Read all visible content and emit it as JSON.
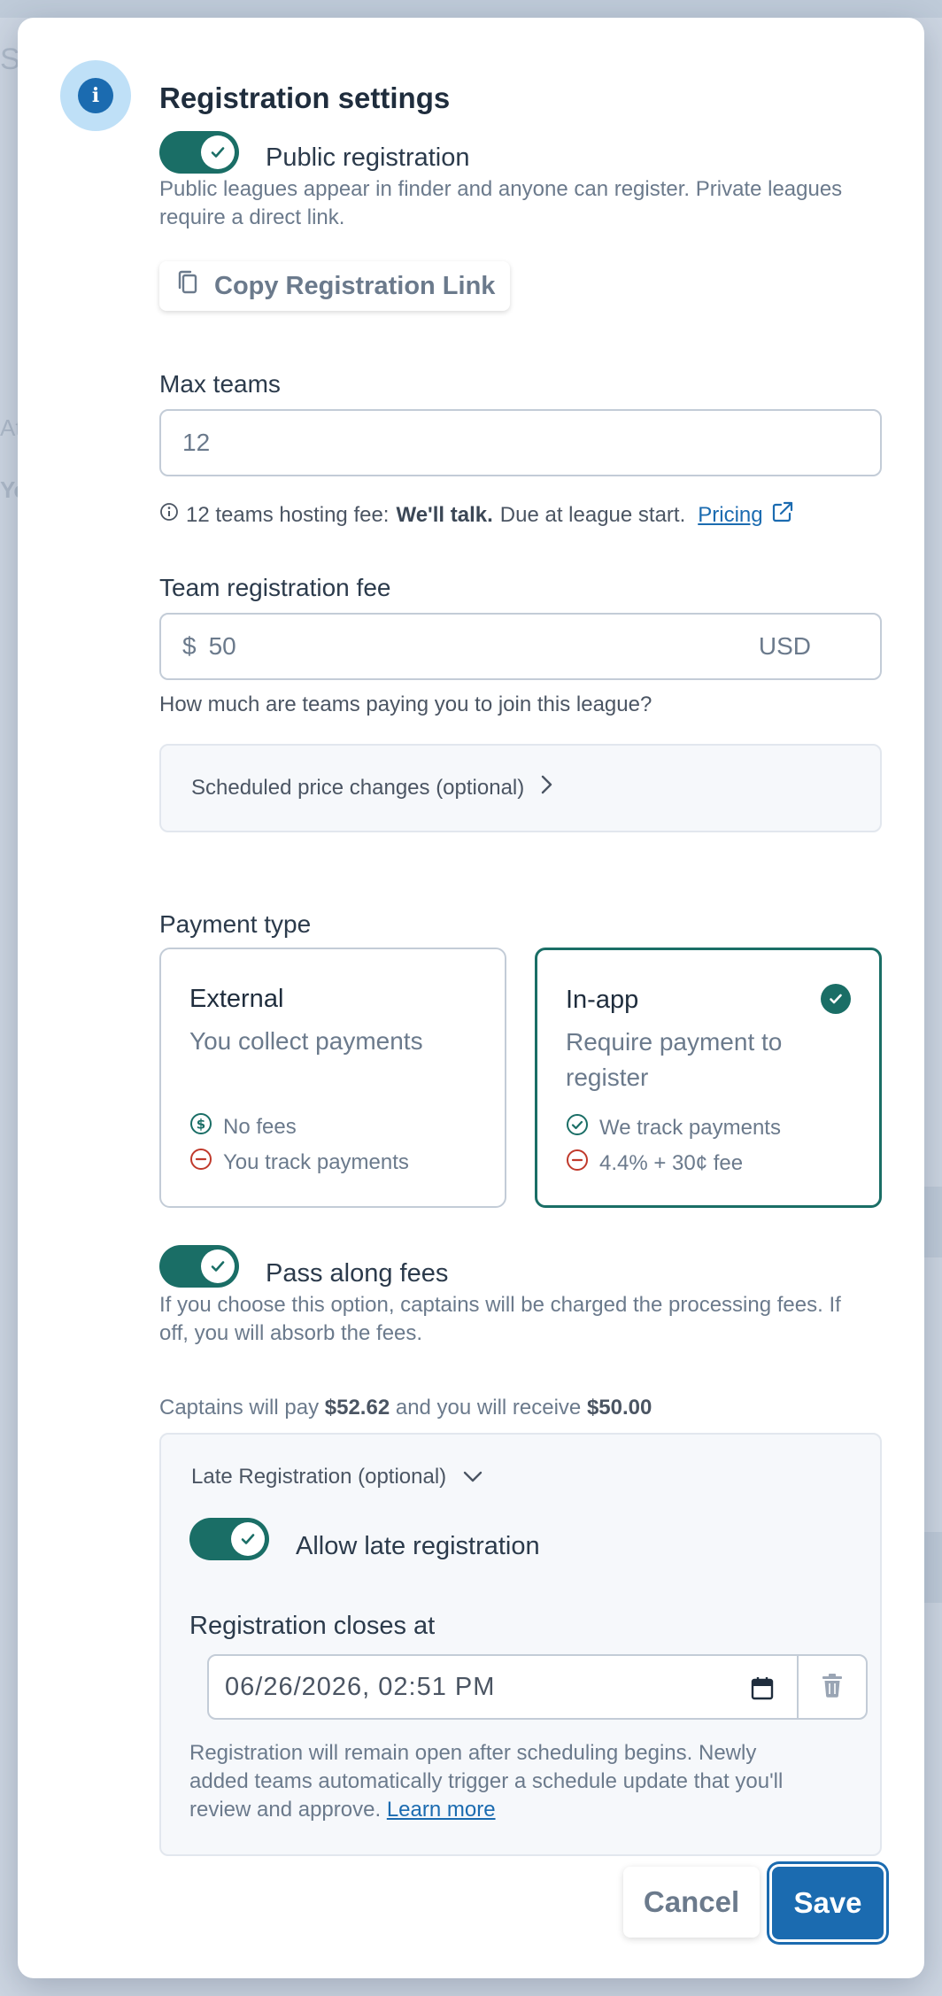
{
  "background": {
    "fragments": [
      "Sc",
      "At",
      "Yo"
    ]
  },
  "header": {
    "title": "Registration settings",
    "info_icon": "info-icon"
  },
  "public_registration": {
    "enabled": true,
    "label": "Public registration",
    "help_line1": "Public leagues appear in finder and anyone can register. Private leagues",
    "help_line2": "require a direct link.",
    "copy_link_label": "Copy Registration Link"
  },
  "max_teams": {
    "label": "Max teams",
    "value": "12",
    "fee_prefix": "12 teams hosting fee:",
    "fee_amount": "We'll talk.",
    "fee_suffix": "Due at league start.",
    "pricing_link": "Pricing"
  },
  "team_fee": {
    "label": "Team registration fee",
    "currency_symbol": "$",
    "value": "50",
    "currency": "USD",
    "help": "How much are teams paying you to join this league?",
    "scheduled_changes": "Scheduled price changes (optional)"
  },
  "payment_type": {
    "label": "Payment type",
    "options": [
      {
        "title": "External",
        "subtitle": "You collect payments",
        "features": [
          "No fees",
          "You track payments"
        ],
        "selected": false
      },
      {
        "title": "In-app",
        "subtitle": "Require payment to register",
        "features": [
          "We track payments",
          "4.4% + 30¢ fee"
        ],
        "selected": true
      }
    ]
  },
  "pass_fees": {
    "enabled": true,
    "label": "Pass along fees",
    "help_line1": "If you choose this option, captains will be charged the processing fees. If",
    "help_line2": "off, you will absorb the fees.",
    "summary_prefix": "Captains will pay",
    "captain_amount": "$52.62",
    "summary_middle": "and you will receive",
    "receive_amount": "$50.00"
  },
  "late_registration": {
    "section_title": "Late Registration (optional)",
    "enabled": true,
    "toggle_label": "Allow late registration",
    "closes_label": "Registration closes at",
    "closes_value": "06/26/2026, 02:51 PM",
    "help_line1": "Registration will remain open after scheduling begins. Newly",
    "help_line2": "added teams automatically trigger a schedule update that you'll",
    "help_line3": "review and approve.",
    "learn_more": "Learn more"
  },
  "footer": {
    "cancel_label": "Cancel",
    "save_label": "Save"
  },
  "colors": {
    "accent_teal": "#1a6e66",
    "primary_blue": "#1b6bb0",
    "danger_red": "#c0392b"
  }
}
